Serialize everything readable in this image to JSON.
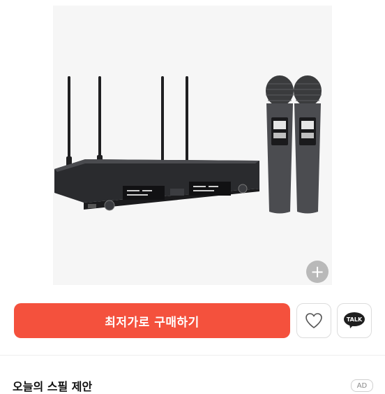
{
  "product": {
    "image_alt": "무선 마이크 세트",
    "zoom_symbol": "+"
  },
  "actions": {
    "buy_label": "최저가로 구매하기",
    "talk_label": "TALK"
  },
  "recommendation": {
    "title": "오늘의 스필 제안",
    "ad_badge": "AD"
  },
  "colors": {
    "accent": "#f4513d",
    "image_bg": "#f6f6f6"
  }
}
